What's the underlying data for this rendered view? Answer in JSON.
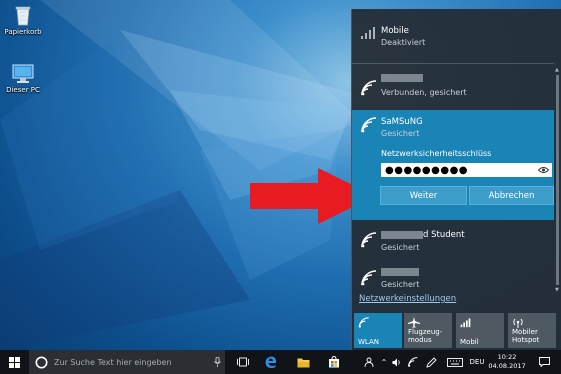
{
  "desktop": {
    "icons": [
      {
        "label": "Papierkorb",
        "icon": "recycle-bin-icon"
      },
      {
        "label": "Dieser PC",
        "icon": "computer-icon"
      }
    ]
  },
  "network_flyout": {
    "networks": [
      {
        "title": "Mobile",
        "subtitle": "Deaktiviert",
        "icon": "cellular-signal-icon"
      },
      {
        "title": "",
        "subtitle": "Verbunden, gesichert",
        "icon": "wifi-icon"
      },
      {
        "title": "SaMSuNG",
        "subtitle": "Gesichert",
        "icon": "wifi-secure-icon"
      },
      {
        "title": "d Student",
        "subtitle": "Gesichert",
        "icon": "wifi-secure-icon"
      },
      {
        "title": "",
        "subtitle": "Gesichert",
        "icon": "wifi-secure-icon"
      }
    ],
    "security_key": {
      "label": "Netzwerksicherheitsschlüss",
      "value": "●●●●●●●●●"
    },
    "buttons": {
      "next": "Weiter",
      "cancel": "Abbrechen"
    },
    "settings_link": "Netzwerkeinstellungen",
    "quick_actions": [
      {
        "label": "WLAN",
        "icon": "wifi-icon",
        "active": true
      },
      {
        "label": "Flugzeug-\nmodus",
        "icon": "airplane-icon",
        "active": false
      },
      {
        "label": "Mobil",
        "icon": "cellular-signal-icon",
        "active": false
      },
      {
        "label": "Mobiler\nHotspot",
        "icon": "hotspot-icon",
        "active": false
      }
    ],
    "accent_color": "#1a84b6"
  },
  "taskbar": {
    "search_placeholder": "Zur Suche Text hier eingeben",
    "language": "DEU",
    "time": "10:22",
    "date": "04.08.2017"
  }
}
